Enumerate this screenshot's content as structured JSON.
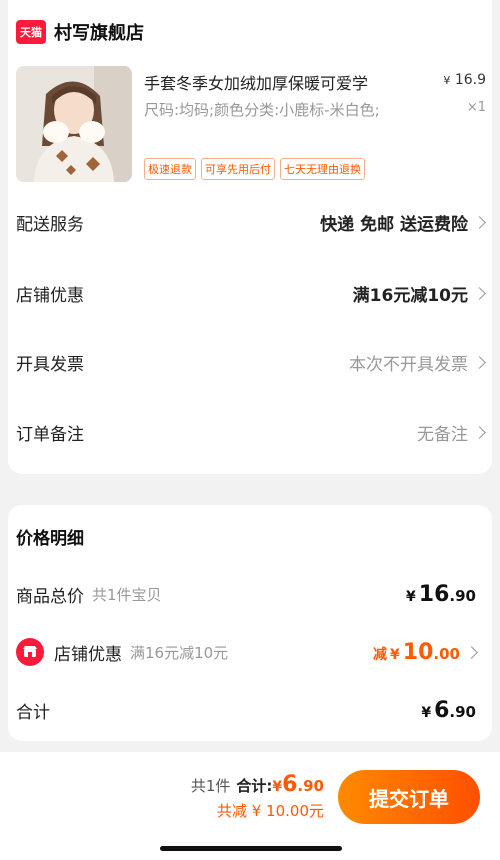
{
  "store": {
    "badge": "天猫",
    "name": "村写旗舰店"
  },
  "product": {
    "title": "手套冬季女加绒加厚保暖可爱学",
    "price_symbol": "¥",
    "price": "16.9",
    "spec": "尺码:均码;颜色分类:小鹿标-米白色;",
    "qty": "×1",
    "tags": [
      "极速退款",
      "可享先用后付",
      "七天无理由退换"
    ]
  },
  "order_rows": [
    {
      "label": "配送服务",
      "value": "快递 免邮 送运费险"
    },
    {
      "label": "店铺优惠",
      "value": "满16元减10元"
    },
    {
      "label": "开具发票",
      "value": "本次不开具发票"
    },
    {
      "label": "订单备注",
      "value": "无备注"
    }
  ],
  "price_detail": {
    "title": "价格明细",
    "goods_total": {
      "label": "商品总价",
      "sub": "共1件宝贝",
      "yen": "¥",
      "int": "16",
      "dec": ".90"
    },
    "store_discount": {
      "label": "店铺优惠",
      "sub": "满16元减10元",
      "prefix": "减",
      "yen": "¥",
      "int": "10",
      "dec": ".00"
    },
    "total": {
      "label": "合计",
      "yen": "¥",
      "int": "6",
      "dec": ".90"
    }
  },
  "bottom_bar": {
    "count": "共1件",
    "total_label": "合计:",
    "yen": "¥",
    "int": "6",
    "dec": ".90",
    "reduce_text": "共减 ¥ 10.00元",
    "submit": "提交订单"
  },
  "colors": {
    "accent": "#ff5a00",
    "tmall_red": "#ff1a3c",
    "background": "#f2f2f2"
  }
}
